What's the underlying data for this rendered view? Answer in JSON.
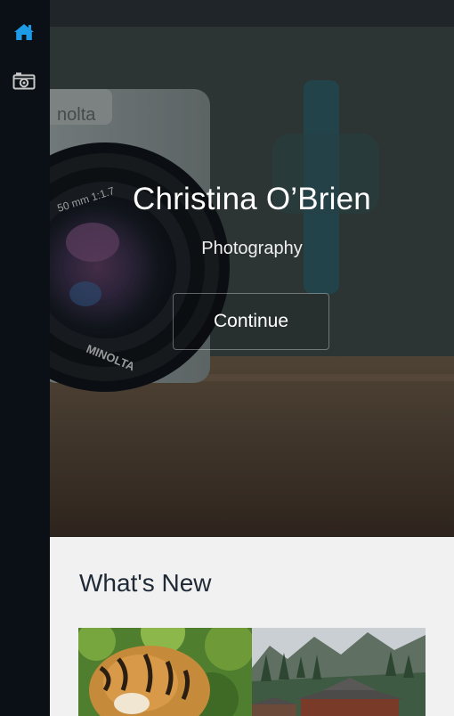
{
  "sidebar": {
    "items": [
      {
        "icon": "home-icon",
        "active": true
      },
      {
        "icon": "camera-icon",
        "active": false
      }
    ],
    "active_color": "#1e9be6",
    "icon_color": "#c8c8c8"
  },
  "hero": {
    "title": "Christina O’Brien",
    "subtitle": "Photography",
    "button_label": "Continue",
    "lens_text": "50 mm 1:1.7",
    "brand_text": "MINOLTA",
    "top_text": "nolta"
  },
  "whats_new": {
    "title": "What's New",
    "images": [
      "tiger-photo",
      "temple-photo"
    ]
  }
}
